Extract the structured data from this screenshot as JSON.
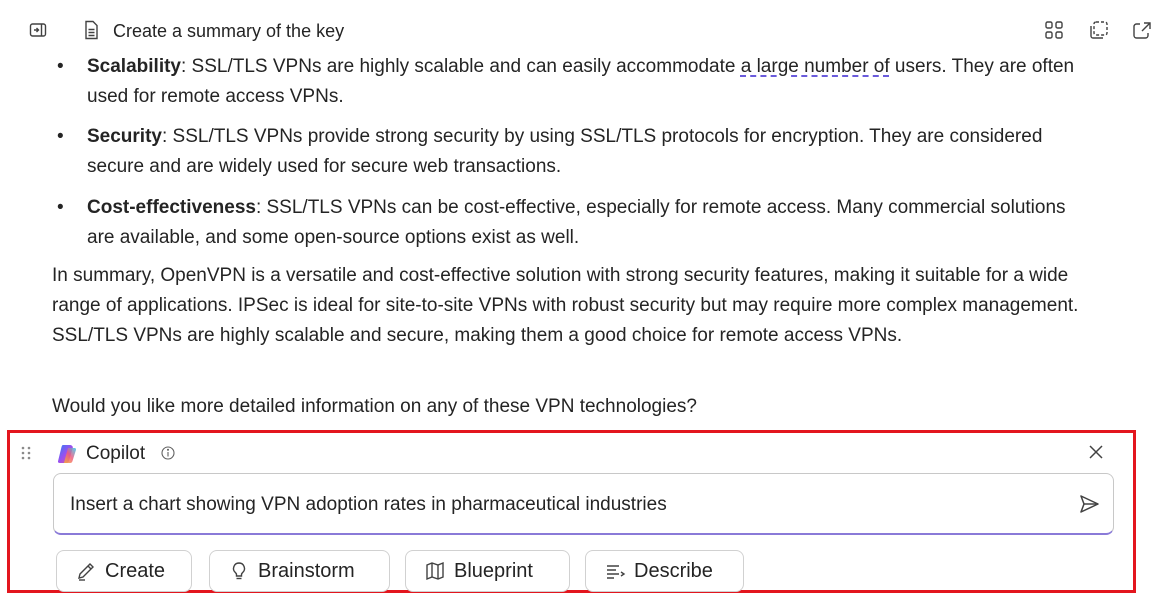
{
  "header": {
    "title": "Create a summary of the key",
    "icons": [
      "panel-toggle-icon",
      "document-icon",
      "apps-icon",
      "copy-icon",
      "share-icon"
    ]
  },
  "document": {
    "bullets": [
      {
        "term": "Scalability",
        "text_before": ": SSL/TLS VPNs are highly scalable and can easily accommodate ",
        "flagged": "a large number of",
        "text_after": " users. They are often used for remote access VPNs."
      },
      {
        "term": "Security",
        "text": ": SSL/TLS VPNs provide strong security by using SSL/TLS protocols for encryption. They are considered secure and are widely used for secure web transactions."
      },
      {
        "term": "Cost-effectiveness",
        "text": ": SSL/TLS VPNs can be cost-effective, especially for remote access. Many commercial solutions are available, and some open-source options exist as well."
      }
    ],
    "summary": "In summary, OpenVPN is a versatile and cost-effective solution with strong security features, making it suitable for a wide range of applications. IPSec is ideal for site-to-site VPNs with robust security but may require more complex management. SSL/TLS VPNs are highly scalable and secure, making them a good choice for remote access VPNs.",
    "question": "Would you like more detailed information on any of these VPN technologies?"
  },
  "copilot": {
    "name": "Copilot",
    "prompt_value": "Insert a chart showing VPN adoption rates in pharmaceutical industries",
    "actions": [
      {
        "label": "Create",
        "icon": "pen-icon"
      },
      {
        "label": "Brainstorm",
        "icon": "lightbulb-icon"
      },
      {
        "label": "Blueprint",
        "icon": "map-icon"
      },
      {
        "label": "Describe",
        "icon": "describe-icon"
      }
    ],
    "highlight_color": "#e3161e",
    "accent_color": "#8a7ad8"
  }
}
